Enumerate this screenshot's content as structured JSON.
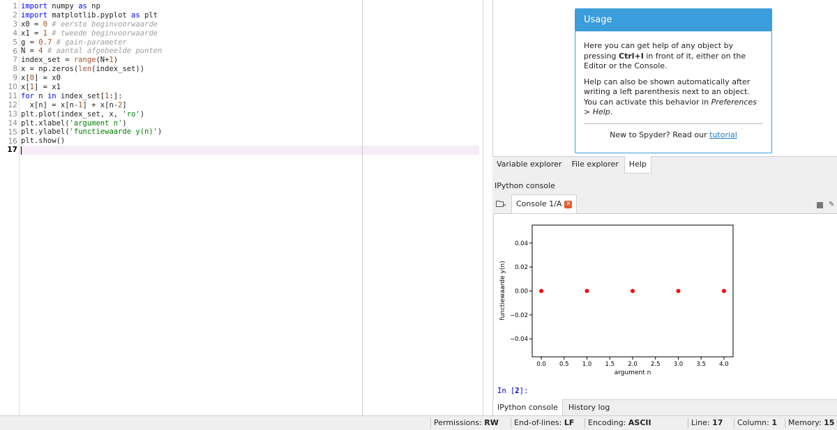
{
  "editor": {
    "line_numbers": [
      "1",
      "2",
      "3",
      "4",
      "5",
      "6",
      "7",
      "8",
      "9",
      "10",
      "11",
      "12",
      "13",
      "14",
      "15",
      "16",
      "17"
    ],
    "current_line": "17",
    "lines": [
      [
        {
          "t": "import",
          "c": "kw"
        },
        {
          "t": " numpy "
        },
        {
          "t": "as",
          "c": "kw"
        },
        {
          "t": " np"
        }
      ],
      [
        {
          "t": "import",
          "c": "kw"
        },
        {
          "t": " matplotlib.pyplot "
        },
        {
          "t": "as",
          "c": "kw"
        },
        {
          "t": " plt"
        }
      ],
      [
        {
          "t": "x0 = "
        },
        {
          "t": "0",
          "c": "num"
        },
        {
          "t": " # eerste beginvoorwaarde",
          "c": "com"
        }
      ],
      [
        {
          "t": "x1 = "
        },
        {
          "t": "1",
          "c": "num"
        },
        {
          "t": " # tweede beginvoorwaarde",
          "c": "com"
        }
      ],
      [
        {
          "t": "g = "
        },
        {
          "t": "0.7",
          "c": "num"
        },
        {
          "t": " # gain-parameter",
          "c": "com"
        }
      ],
      [
        {
          "t": "N = "
        },
        {
          "t": "4",
          "c": "num"
        },
        {
          "t": " # aantal afgebeelde punten",
          "c": "com"
        }
      ],
      [
        {
          "t": "index_set = "
        },
        {
          "t": "range",
          "c": "bi"
        },
        {
          "t": "(N+"
        },
        {
          "t": "1",
          "c": "num"
        },
        {
          "t": ")"
        }
      ],
      [
        {
          "t": "x = np.zeros("
        },
        {
          "t": "len",
          "c": "bi"
        },
        {
          "t": "(index_set))"
        }
      ],
      [
        {
          "t": "x["
        },
        {
          "t": "0",
          "c": "num"
        },
        {
          "t": "] = x0"
        }
      ],
      [
        {
          "t": "x["
        },
        {
          "t": "1",
          "c": "num"
        },
        {
          "t": "] = x1"
        }
      ],
      [
        {
          "t": "for",
          "c": "kw"
        },
        {
          "t": " n "
        },
        {
          "t": "in",
          "c": "kw"
        },
        {
          "t": " index_set["
        },
        {
          "t": "1",
          "c": "num"
        },
        {
          "t": ":]:"
        }
      ],
      [
        {
          "t": "  x[n] = x[n-"
        },
        {
          "t": "1",
          "c": "num"
        },
        {
          "t": "] + x[n-"
        },
        {
          "t": "2",
          "c": "num"
        },
        {
          "t": "]"
        }
      ],
      [
        {
          "t": "plt.plot(index_set, x, "
        },
        {
          "t": "'ro'",
          "c": "str"
        },
        {
          "t": ")"
        }
      ],
      [
        {
          "t": "plt.xlabel("
        },
        {
          "t": "'argument n'",
          "c": "str"
        },
        {
          "t": ")"
        }
      ],
      [
        {
          "t": "plt.ylabel("
        },
        {
          "t": "'functiewaarde y(n)'",
          "c": "str"
        },
        {
          "t": ")"
        }
      ],
      [
        {
          "t": "plt.show()"
        }
      ],
      [
        {
          "t": ""
        }
      ]
    ]
  },
  "help": {
    "title": "Usage",
    "p1_pre": "Here you can get help of any object by pressing ",
    "p1_bold": "Ctrl+I",
    "p1_post": " in front of it, either on the Editor or the Console.",
    "p2_pre": "Help can also be shown automatically after writing a left parenthesis next to an object. You can activate this behavior in ",
    "p2_italic": "Preferences > Help",
    "p2_post": ".",
    "footer_pre": "New to Spyder? Read our ",
    "footer_link": "tutorial"
  },
  "top_tabs": [
    "Variable explorer",
    "File explorer",
    "Help"
  ],
  "pane_title": "IPython console",
  "console_tab": "Console 1/A",
  "prompt": {
    "pre": "In [",
    "num": "2",
    "post": "]:"
  },
  "bottom_tabs": [
    "IPython console",
    "History log"
  ],
  "status": [
    {
      "label": "Permissions:",
      "value": "RW"
    },
    {
      "label": "End-of-lines:",
      "value": "LF"
    },
    {
      "label": "Encoding:",
      "value": "ASCII"
    },
    {
      "label": "Line:",
      "value": "17"
    },
    {
      "label": "Column:",
      "value": "1"
    },
    {
      "label": "Memory:",
      "value": "15"
    }
  ],
  "chart_data": {
    "type": "scatter",
    "x": [
      0,
      1,
      2,
      3,
      4
    ],
    "y": [
      0,
      0,
      0,
      0,
      0
    ],
    "marker_color": "#ff0000",
    "xlabel": "argument n",
    "ylabel": "functiewaarde y(n)",
    "xlim": [
      -0.2,
      4.2
    ],
    "ylim": [
      -0.055,
      0.055
    ],
    "xticks": [
      "0.0",
      "0.5",
      "1.0",
      "1.5",
      "2.0",
      "2.5",
      "3.0",
      "3.5",
      "4.0"
    ],
    "xtick_values": [
      0,
      0.5,
      1,
      1.5,
      2,
      2.5,
      3,
      3.5,
      4
    ],
    "yticks": [
      "0.04",
      "0.02",
      "0.00",
      "−0.02",
      "−0.04"
    ],
    "ytick_values": [
      0.04,
      0.02,
      0,
      -0.02,
      -0.04
    ]
  }
}
